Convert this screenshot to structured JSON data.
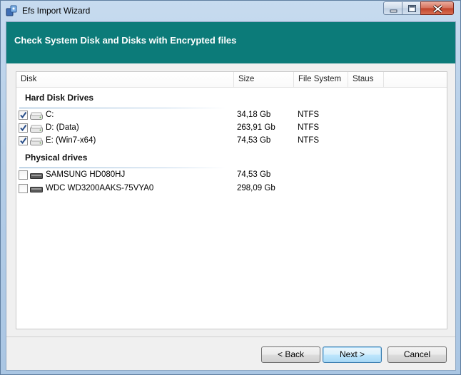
{
  "window": {
    "title": "Efs Import Wizard"
  },
  "banner": {
    "title": "Check System Disk and Disks with Encrypted files"
  },
  "columns": [
    "Disk",
    "Size",
    "File System",
    "Staus"
  ],
  "groups": [
    {
      "title": "Hard Disk Drives",
      "rows": [
        {
          "name": "C:",
          "size": "34,18 Gb",
          "fs": "NTFS",
          "status": "",
          "checked": true
        },
        {
          "name": "D: (Data)",
          "size": "263,91 Gb",
          "fs": "NTFS",
          "status": "",
          "checked": true
        },
        {
          "name": "E: (Win7-x64)",
          "size": "74,53 Gb",
          "fs": "NTFS",
          "status": "",
          "checked": true
        }
      ]
    },
    {
      "title": "Physical drives",
      "rows": [
        {
          "name": "SAMSUNG HD080HJ",
          "size": "74,53 Gb",
          "fs": "",
          "status": "",
          "checked": false
        },
        {
          "name": "WDC WD3200AAKS-75VYA0",
          "size": "298,09 Gb",
          "fs": "",
          "status": "",
          "checked": false
        }
      ]
    }
  ],
  "buttons": {
    "back": "< Back",
    "next": "Next >",
    "cancel": "Cancel"
  },
  "colors": {
    "banner": "#0c7b79",
    "check": "#2a4f8a"
  }
}
